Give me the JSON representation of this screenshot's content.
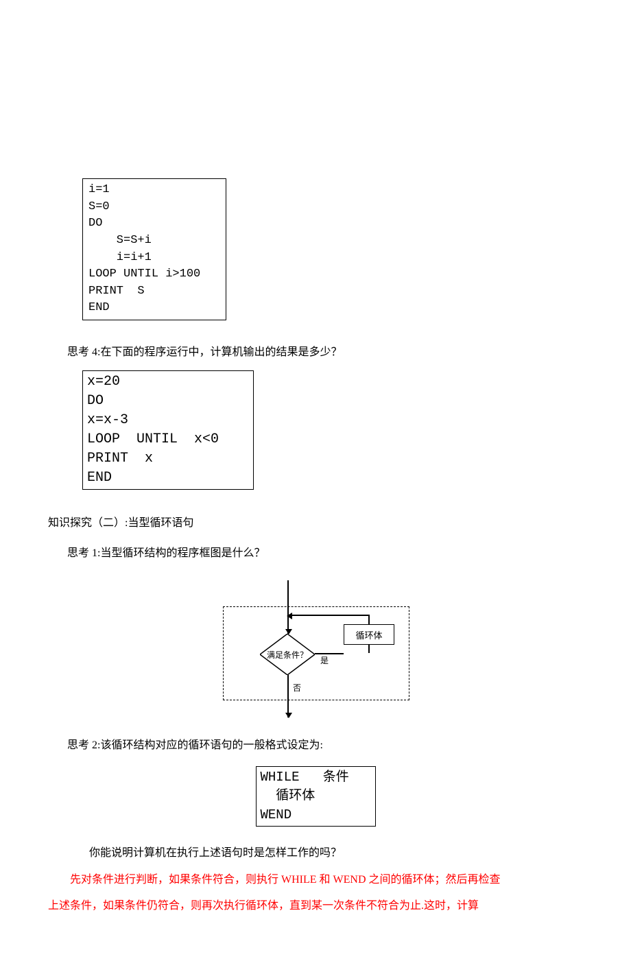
{
  "code1": "i=1\nS=0\nDO\n    S=S+i\n    i=i+1\nLOOP UNTIL i>100\nPRINT  S\nEND",
  "think4": "思考 4:在下面的程序运行中，计算机输出的结果是多少？",
  "code2": "x=20\nDO\nx=x-3\nLOOP  UNTIL  x<0\nPRINT  x\nEND",
  "section2": "知识探究（二）:当型循环语句",
  "think1": "思考 1:当型循环结构的程序框图是什么？",
  "flow": {
    "cond": "满足条件？",
    "body": "循环体",
    "yes": "是",
    "no": "否"
  },
  "think2": "思考 2:该循环结构对应的循环语句的一般格式设定为:",
  "code3": "WHILE   条件\n  循环体\nWEND",
  "think_exec": "你能说明计算机在执行上述语句时是怎样工作的吗？",
  "red1": "先对条件进行判断，如果条件符合，则执行 WHILE 和 WEND 之间的循环体；然后再检查",
  "red2": "上述条件，如果条件仍符合，则再次执行循环体，直到某一次条件不符合为止.这时，计算"
}
